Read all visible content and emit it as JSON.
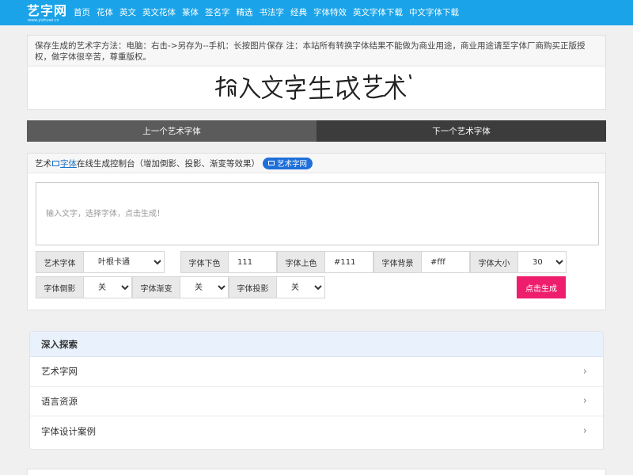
{
  "site": {
    "logo_main": "艺字网",
    "logo_sub": "www.yizhuwi.cn"
  },
  "nav": {
    "items": [
      "首页",
      "花体",
      "英文",
      "英文花体",
      "篆体",
      "签名字",
      "精选",
      "书法字",
      "经典",
      "字体特效",
      "英文字体下载",
      "中文字体下载"
    ]
  },
  "notice": {
    "text": "保存生成的艺术字方法：电脑：右击->另存为--手机：长按图片保存 注：本站所有转换字体结果不能做为商业用途，商业用途请至字体厂商购买正版授权，做字体很辛苦，尊重版权。",
    "art_text": "输入文字生成艺术字体"
  },
  "prevnext": {
    "prev_label": "上一个艺术字体",
    "next_label": "下一个艺术字体"
  },
  "generator": {
    "head_pre": "艺术",
    "head_link": "字体",
    "head_post": "在线生成控制台（增加倒影、投影、渐变等效果）",
    "badge_label": "艺术字网",
    "text_placeholder": "输入文字，选择字体，点击生成！",
    "font_label": "艺术字体",
    "font_value": "叶根卡通",
    "bottom_color_label": "字体下色",
    "bottom_color_value": "111",
    "top_color_label": "字体上色",
    "top_color_value": "#111",
    "bg_label": "字体背景",
    "bg_value": "#fff",
    "size_label": "字体大小",
    "size_value": "30",
    "reflect_label": "字体倒影",
    "reflect_value": "关",
    "gradient_label": "字体渐变",
    "gradient_value": "关",
    "shadow_label": "字体投影",
    "shadow_value": "关",
    "generate_label": "点击生成"
  },
  "explore": {
    "title": "深入探索",
    "items": [
      "艺术字网",
      "语言资源",
      "字体设计案例"
    ]
  },
  "colors": {
    "topbar": "#1aa3e8",
    "generate_button": "#ef1e6d",
    "badge": "#1e6fd9",
    "prev_bg": "#5b5b5b",
    "next_bg": "#3c3c3c"
  },
  "icons": {
    "chevron": "chevron-right-icon"
  }
}
